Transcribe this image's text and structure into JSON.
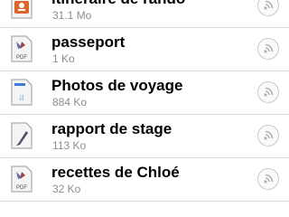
{
  "files": [
    {
      "name": "itinéraire de rando",
      "size": "31.1 Mo",
      "icon": "map-file-icon"
    },
    {
      "name": "passeport",
      "size": "1 Ko",
      "icon": "pdf-file-icon",
      "badge": "PDF"
    },
    {
      "name": "Photos de voyage",
      "size": "884 Ko",
      "icon": "document-file-icon"
    },
    {
      "name": "rapport de stage",
      "size": "113 Ko",
      "icon": "pen-document-icon"
    },
    {
      "name": "recettes de Chloé",
      "size": "32 Ko",
      "icon": "pdf-file-icon",
      "badge": "PDF"
    }
  ],
  "share_icon": "wifi-share-icon",
  "colors": {
    "separator": "#d9d9d9",
    "subtitle": "#8c8c8c"
  }
}
